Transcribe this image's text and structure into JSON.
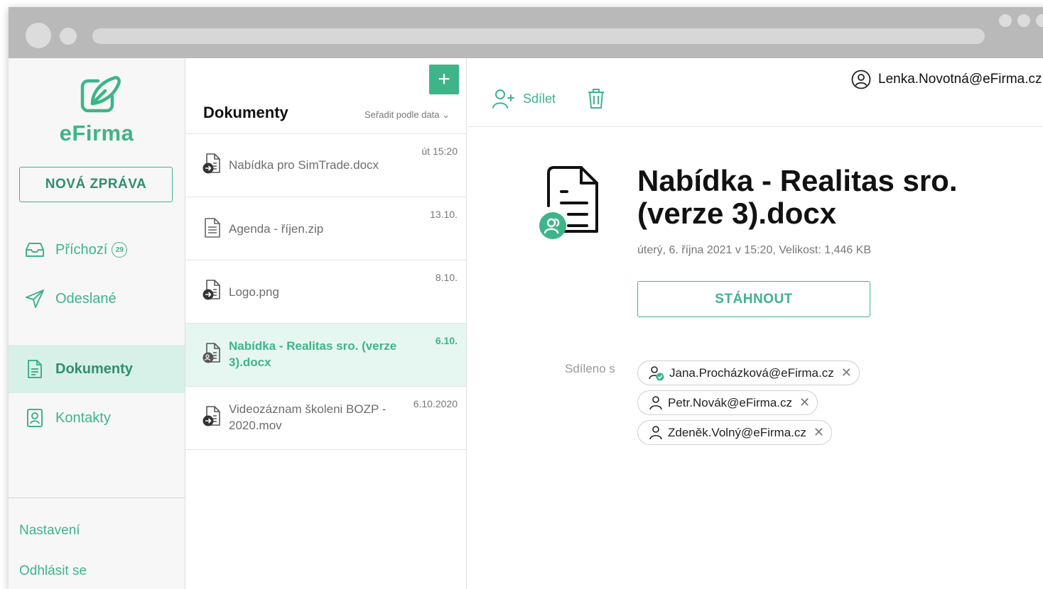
{
  "app": {
    "name": "eFirma",
    "brand_color": "#3eb489",
    "accent_dark": "#2e8f6d"
  },
  "sidebar": {
    "new_message_label": "NOVÁ ZPRÁVA",
    "items": [
      {
        "label": "Příchozí",
        "icon": "inbox-icon",
        "badge": "29"
      },
      {
        "label": "Odeslané",
        "icon": "send-icon"
      },
      {
        "label": "Dokumenty",
        "icon": "document-icon",
        "active": true
      },
      {
        "label": "Kontakty",
        "icon": "contact-icon"
      }
    ],
    "footer": {
      "settings": "Nastavení",
      "logout": "Odhlásit se"
    }
  },
  "list": {
    "title": "Dokumenty",
    "sort_label": "Seřadit podle data ⌄",
    "add_icon": "plus-icon",
    "rows": [
      {
        "name": "Nabídka pro SimTrade.docx",
        "date": "út 15:20",
        "icon": "received-doc-icon"
      },
      {
        "name": "Agenda - říjen.zip",
        "date": "13.10.",
        "icon": "doc-icon"
      },
      {
        "name": "Logo.png",
        "date": "8.10.",
        "icon": "received-doc-icon"
      },
      {
        "name": "Nabídka - Realitas sro. (verze 3).docx",
        "date": "6.10.",
        "icon": "shared-doc-icon",
        "selected": true
      },
      {
        "name": "Videozáznam školeni BOZP - 2020.mov",
        "date": "6.10.2020",
        "icon": "received-doc-icon"
      }
    ]
  },
  "detail": {
    "share_label": "Sdílet",
    "user_email": "Lenka.Novotná@eFirma.cz",
    "title": "Nabídka - Realitas sro. (verze 3).docx",
    "meta": "úterý, 6. října 2021 v 15:20, Velikost: 1,446 KB",
    "download_label": "STÁHNOUT",
    "shared_label": "Sdíleno s",
    "shared_with": [
      {
        "email": "Jana.Procházková@eFirma.cz",
        "icon": "user-check-icon"
      },
      {
        "email": "Petr.Novák@eFirma.cz",
        "icon": "user-icon"
      },
      {
        "email": "Zdeněk.Volný@eFirma.cz",
        "icon": "user-icon"
      }
    ],
    "remove_glyph": "✕"
  }
}
